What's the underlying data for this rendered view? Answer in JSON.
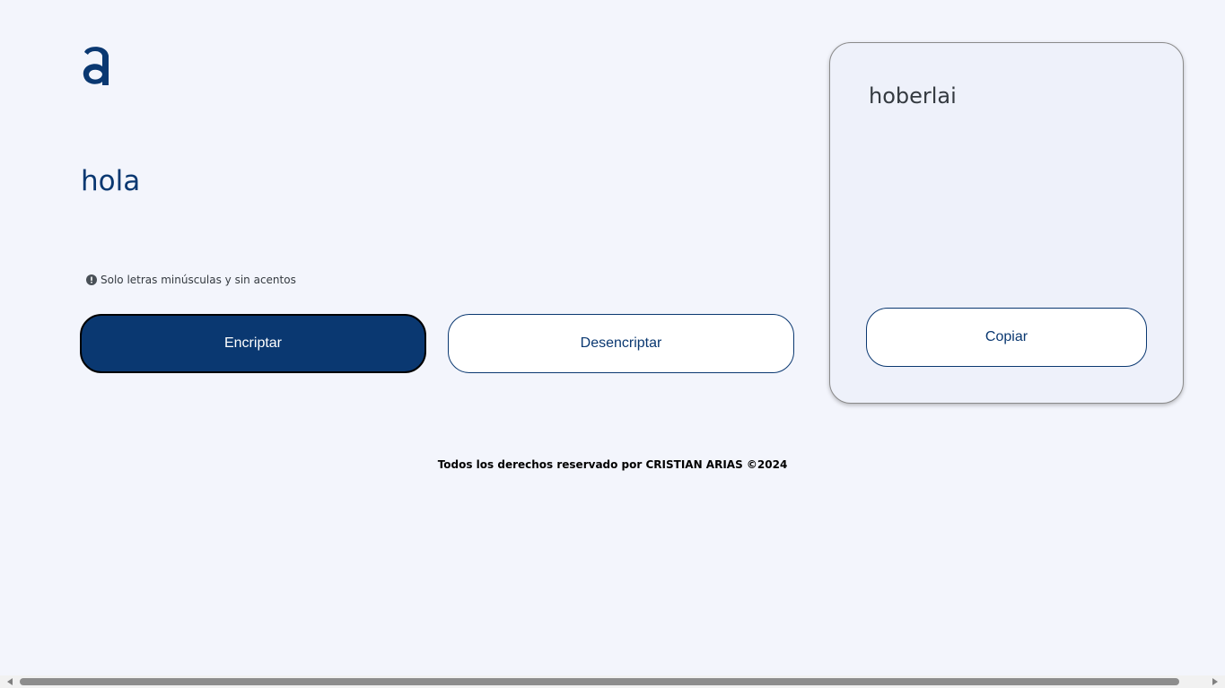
{
  "header": {
    "logo_icon": "alura-logo-icon"
  },
  "input": {
    "value": "hola"
  },
  "hint": {
    "icon": "exclamation-circle-icon",
    "text": "Solo letras minúsculas y sin acentos"
  },
  "actions": {
    "encrypt_label": "Encriptar",
    "decrypt_label": "Desencriptar"
  },
  "output": {
    "text": "hoberlai",
    "copy_label": "Copiar"
  },
  "footer": {
    "text": "Todos los derechos reservado por CRISTIAN ARIAS ©2024"
  },
  "colors": {
    "background": "#f3f5fc",
    "primary": "#0a3871",
    "card_background": "#eef1fa",
    "text_dark": "#343a40"
  }
}
